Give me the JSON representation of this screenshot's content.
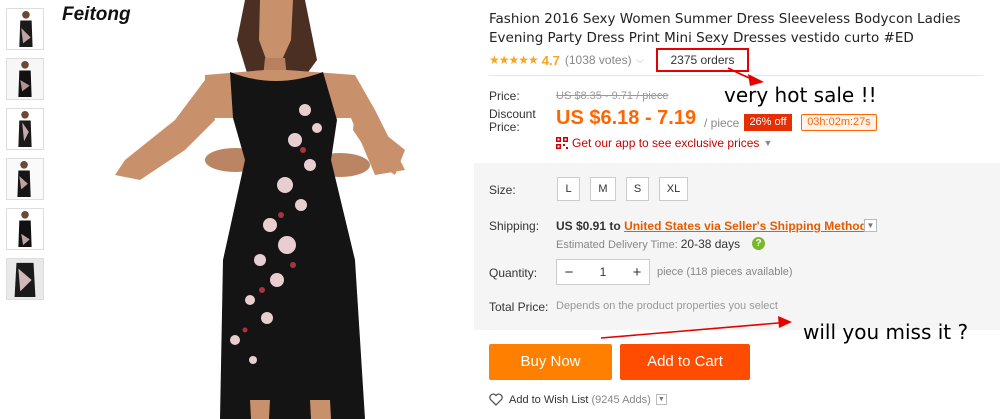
{
  "brand": "Feitong",
  "product": {
    "title": "Fashion 2016 Sexy Women Summer Dress Sleeveless Bodycon Ladies Evening Party Dress Print Mini Sexy Dresses vestido curto #ED",
    "stars": "★★★★★",
    "rating": "4.7",
    "votes": "(1038 votes)",
    "orders": "2375 orders"
  },
  "price": {
    "label": "Price:",
    "original": "US $8.35 - 9.71 / piece",
    "discount_label": "Discount Price:",
    "discount": "US $6.18 - 7.19",
    "unit": "/ piece",
    "off": "26% off",
    "timer": "03h:02m:27s",
    "app_promo": "Get our app to see exclusive prices"
  },
  "size": {
    "label": "Size:",
    "options": [
      "L",
      "M",
      "S",
      "XL"
    ]
  },
  "shipping": {
    "label": "Shipping:",
    "price": "US $0.91",
    "to": "to",
    "method": "United States via Seller's Shipping Method",
    "est_label": "Estimated Delivery Time:",
    "est_days": "20-38 days"
  },
  "quantity": {
    "label": "Quantity:",
    "minus": "−",
    "value": "1",
    "plus": "+",
    "available": "piece (118 pieces available)"
  },
  "total": {
    "label": "Total Price:",
    "note": "Depends on the product properties you select"
  },
  "actions": {
    "buy_now": "Buy Now",
    "add_to_cart": "Add to Cart",
    "wishlist": "Add to Wish List",
    "wishlist_count": "(9245 Adds)"
  },
  "annotations": {
    "hot_sale": "very hot sale !!",
    "miss_it": "will you miss it ?"
  },
  "colors": {
    "accent": "#ff7f00",
    "cart": "#ff4c00",
    "price": "#ff6600",
    "arrow": "#e60000"
  },
  "icons": [
    "qr-code-icon",
    "chevron-down-icon",
    "help-icon",
    "heart-icon"
  ]
}
